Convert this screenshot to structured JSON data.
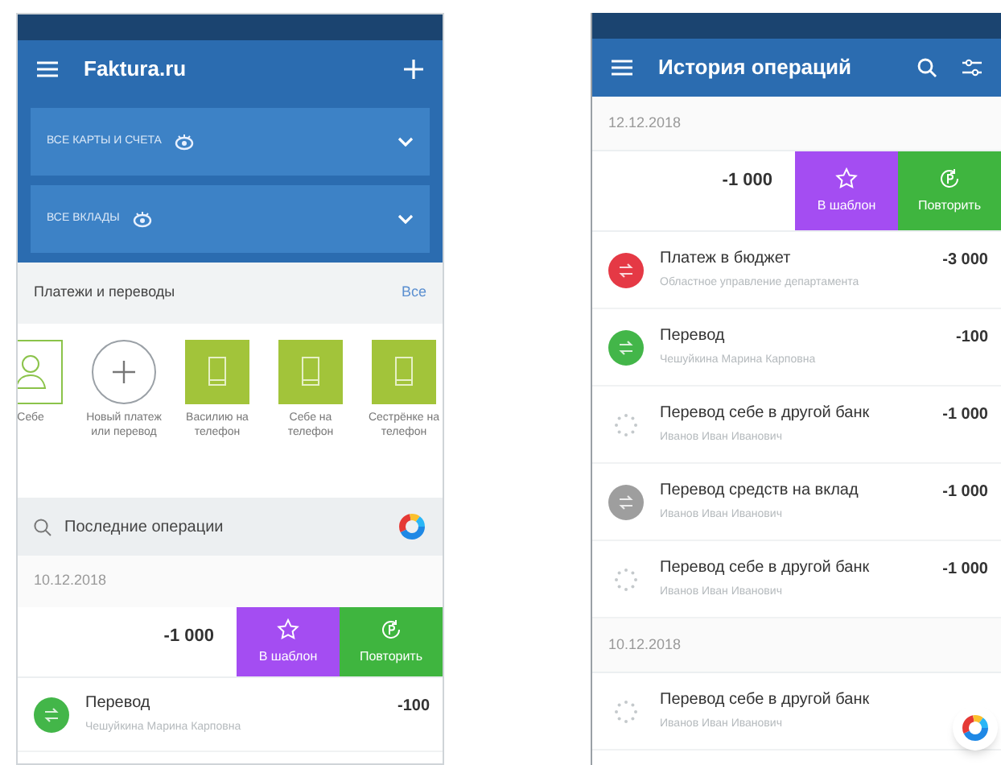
{
  "left_screen": {
    "app_bar": {
      "title": "Faktura.ru"
    },
    "account_dropdowns": [
      {
        "label": "ВСЕ КАРТЫ И СЧЕТА"
      },
      {
        "label": "ВСЕ ВКЛАДЫ"
      }
    ],
    "payments": {
      "title": "Платежи и переводы",
      "link": "Все",
      "shortcuts": [
        {
          "kind": "contact",
          "label": "Себе"
        },
        {
          "kind": "new",
          "label": "Новый платеж или перевод"
        },
        {
          "kind": "phone",
          "label": "Василию на телефон"
        },
        {
          "kind": "phone",
          "label": "Себе на телефон"
        },
        {
          "kind": "phone",
          "label": "Сестрёнке на телефон"
        }
      ]
    },
    "search": {
      "placeholder": "Последние операции"
    },
    "date": "10.12.2018",
    "swiped_row": {
      "amount": "-1 000",
      "actions": [
        {
          "kind": "template",
          "label": "В шаблон"
        },
        {
          "kind": "repeat",
          "label": "Повторить"
        }
      ]
    },
    "operations": [
      {
        "kind": "circle",
        "color": "#43b649",
        "title": "Перевод",
        "subtitle": "Чешуйкина Марина Карповна",
        "amount": "-100"
      }
    ]
  },
  "right_screen": {
    "app_bar": {
      "title": "История операций"
    },
    "groups": [
      {
        "date": "12.12.2018",
        "swiped_row": {
          "amount": "-1 000",
          "actions": [
            {
              "kind": "template",
              "label": "В шаблон"
            },
            {
              "kind": "repeat",
              "label": "Повторить"
            }
          ]
        },
        "operations": [
          {
            "kind": "circle",
            "color": "#e53945",
            "title": "Платеж в бюджет",
            "subtitle": "Областное управление департамента",
            "amount": "-3 000"
          },
          {
            "kind": "circle",
            "color": "#43b649",
            "title": "Перевод",
            "subtitle": "Чешуйкина Марина Карповна",
            "amount": "-100"
          },
          {
            "kind": "loading",
            "title": "Перевод себе в другой банк",
            "subtitle": "Иванов Иван Иванович",
            "amount": "-1 000"
          },
          {
            "kind": "circle",
            "color": "#9e9e9e",
            "title": "Перевод средств на вклад",
            "subtitle": "Иванов Иван Иванович",
            "amount": "-1 000"
          },
          {
            "kind": "loading",
            "title": "Перевод себе в другой банк",
            "subtitle": "Иванов Иван Иванович",
            "amount": "-1 000"
          }
        ]
      },
      {
        "date": "10.12.2018",
        "operations": [
          {
            "kind": "loading",
            "title": "Перевод себе в другой банк",
            "subtitle": "Иванов Иван Иванович"
          }
        ]
      }
    ]
  }
}
